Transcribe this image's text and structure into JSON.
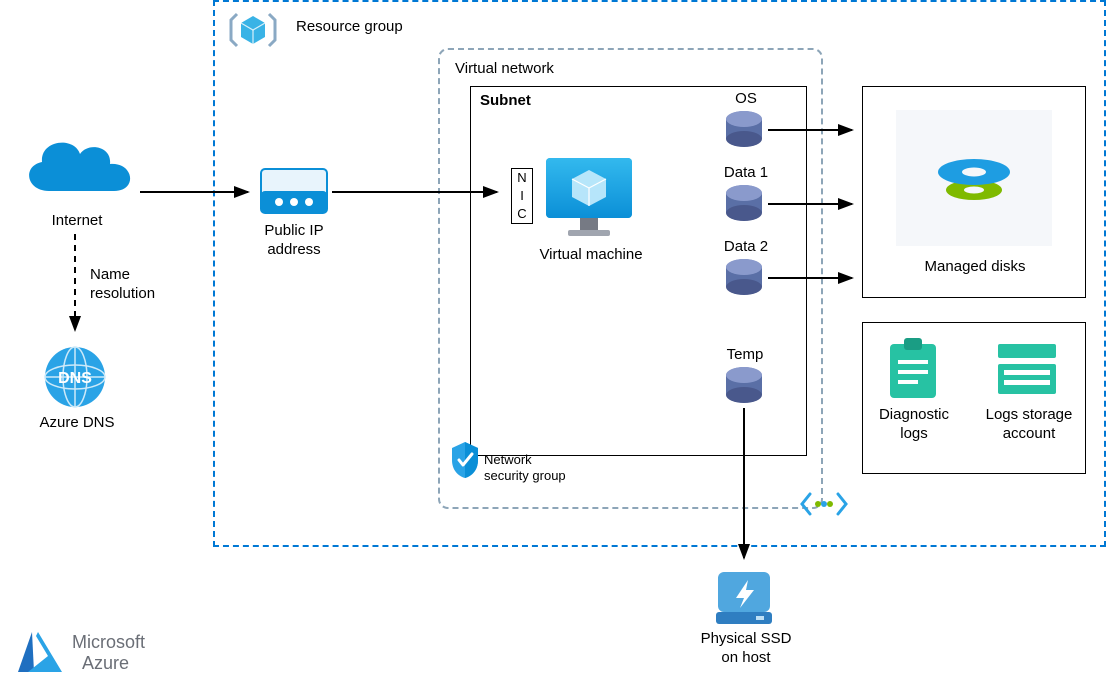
{
  "labels": {
    "resource_group": "Resource group",
    "virtual_network": "Virtual network",
    "subnet": "Subnet",
    "internet": "Internet",
    "name_resolution_1": "Name",
    "name_resolution_2": "resolution",
    "azure_dns": "Azure DNS",
    "public_ip_1": "Public IP",
    "public_ip_2": "address",
    "nic_n": "N",
    "nic_i": "I",
    "nic_c": "C",
    "virtual_machine": "Virtual machine",
    "disk_os": "OS",
    "disk_data1": "Data 1",
    "disk_data2": "Data 2",
    "disk_temp": "Temp",
    "managed_disks": "Managed disks",
    "nsg_1": "Network",
    "nsg_2": "security group",
    "diag_logs_1": "Diagnostic",
    "diag_logs_2": "logs",
    "logs_storage_1": "Logs storage",
    "logs_storage_2": "account",
    "physical_ssd_1": "Physical SSD",
    "physical_ssd_2": "on host",
    "ms_azure_1": "Microsoft",
    "ms_azure_2": "Azure"
  },
  "colors": {
    "azure_blue": "#0078d4",
    "disk_blue": "#5a6fa6",
    "teal": "#27c2a3",
    "green": "#7fba00"
  }
}
